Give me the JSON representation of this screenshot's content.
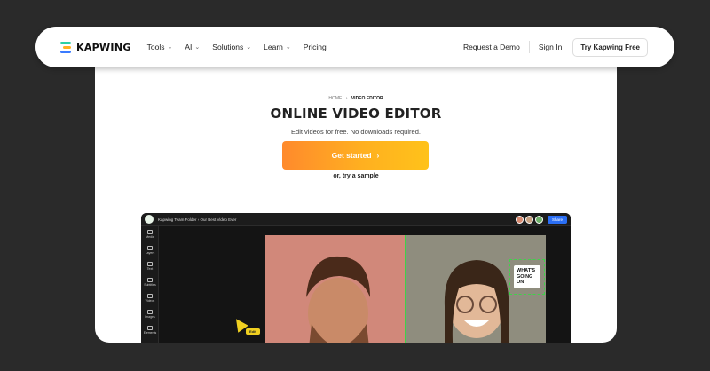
{
  "nav": {
    "logo_text": "KAPWING",
    "menu": [
      {
        "label": "Tools",
        "has_dropdown": true
      },
      {
        "label": "AI",
        "has_dropdown": true
      },
      {
        "label": "Solutions",
        "has_dropdown": true
      },
      {
        "label": "Learn",
        "has_dropdown": true
      },
      {
        "label": "Pricing",
        "has_dropdown": false
      }
    ],
    "request_demo": "Request a Demo",
    "sign_in": "Sign In",
    "try_free": "Try Kapwing Free",
    "logo_colors": [
      "#2bd1a6",
      "#ffb020",
      "#3a7bff"
    ]
  },
  "hero": {
    "breadcrumb_home": "HOME",
    "breadcrumb_sep": "›",
    "breadcrumb_current": "VIDEO EDITOR",
    "title": "ONLINE VIDEO EDITOR",
    "subtitle": "Edit videos for free. No downloads required.",
    "cta_label": "Get started",
    "cta_arrow": "›",
    "sample_link": "or, try a sample"
  },
  "editor": {
    "path": "Kapwing Team Folder  ›  Our Best Video Ever",
    "share": "Share",
    "tools": [
      "Media",
      "Layers",
      "Text",
      "Subtitles",
      "Videos",
      "Images",
      "Elements"
    ],
    "sticker_text": "WHAT'S GOING ON",
    "cursor_tag": "Edit"
  }
}
